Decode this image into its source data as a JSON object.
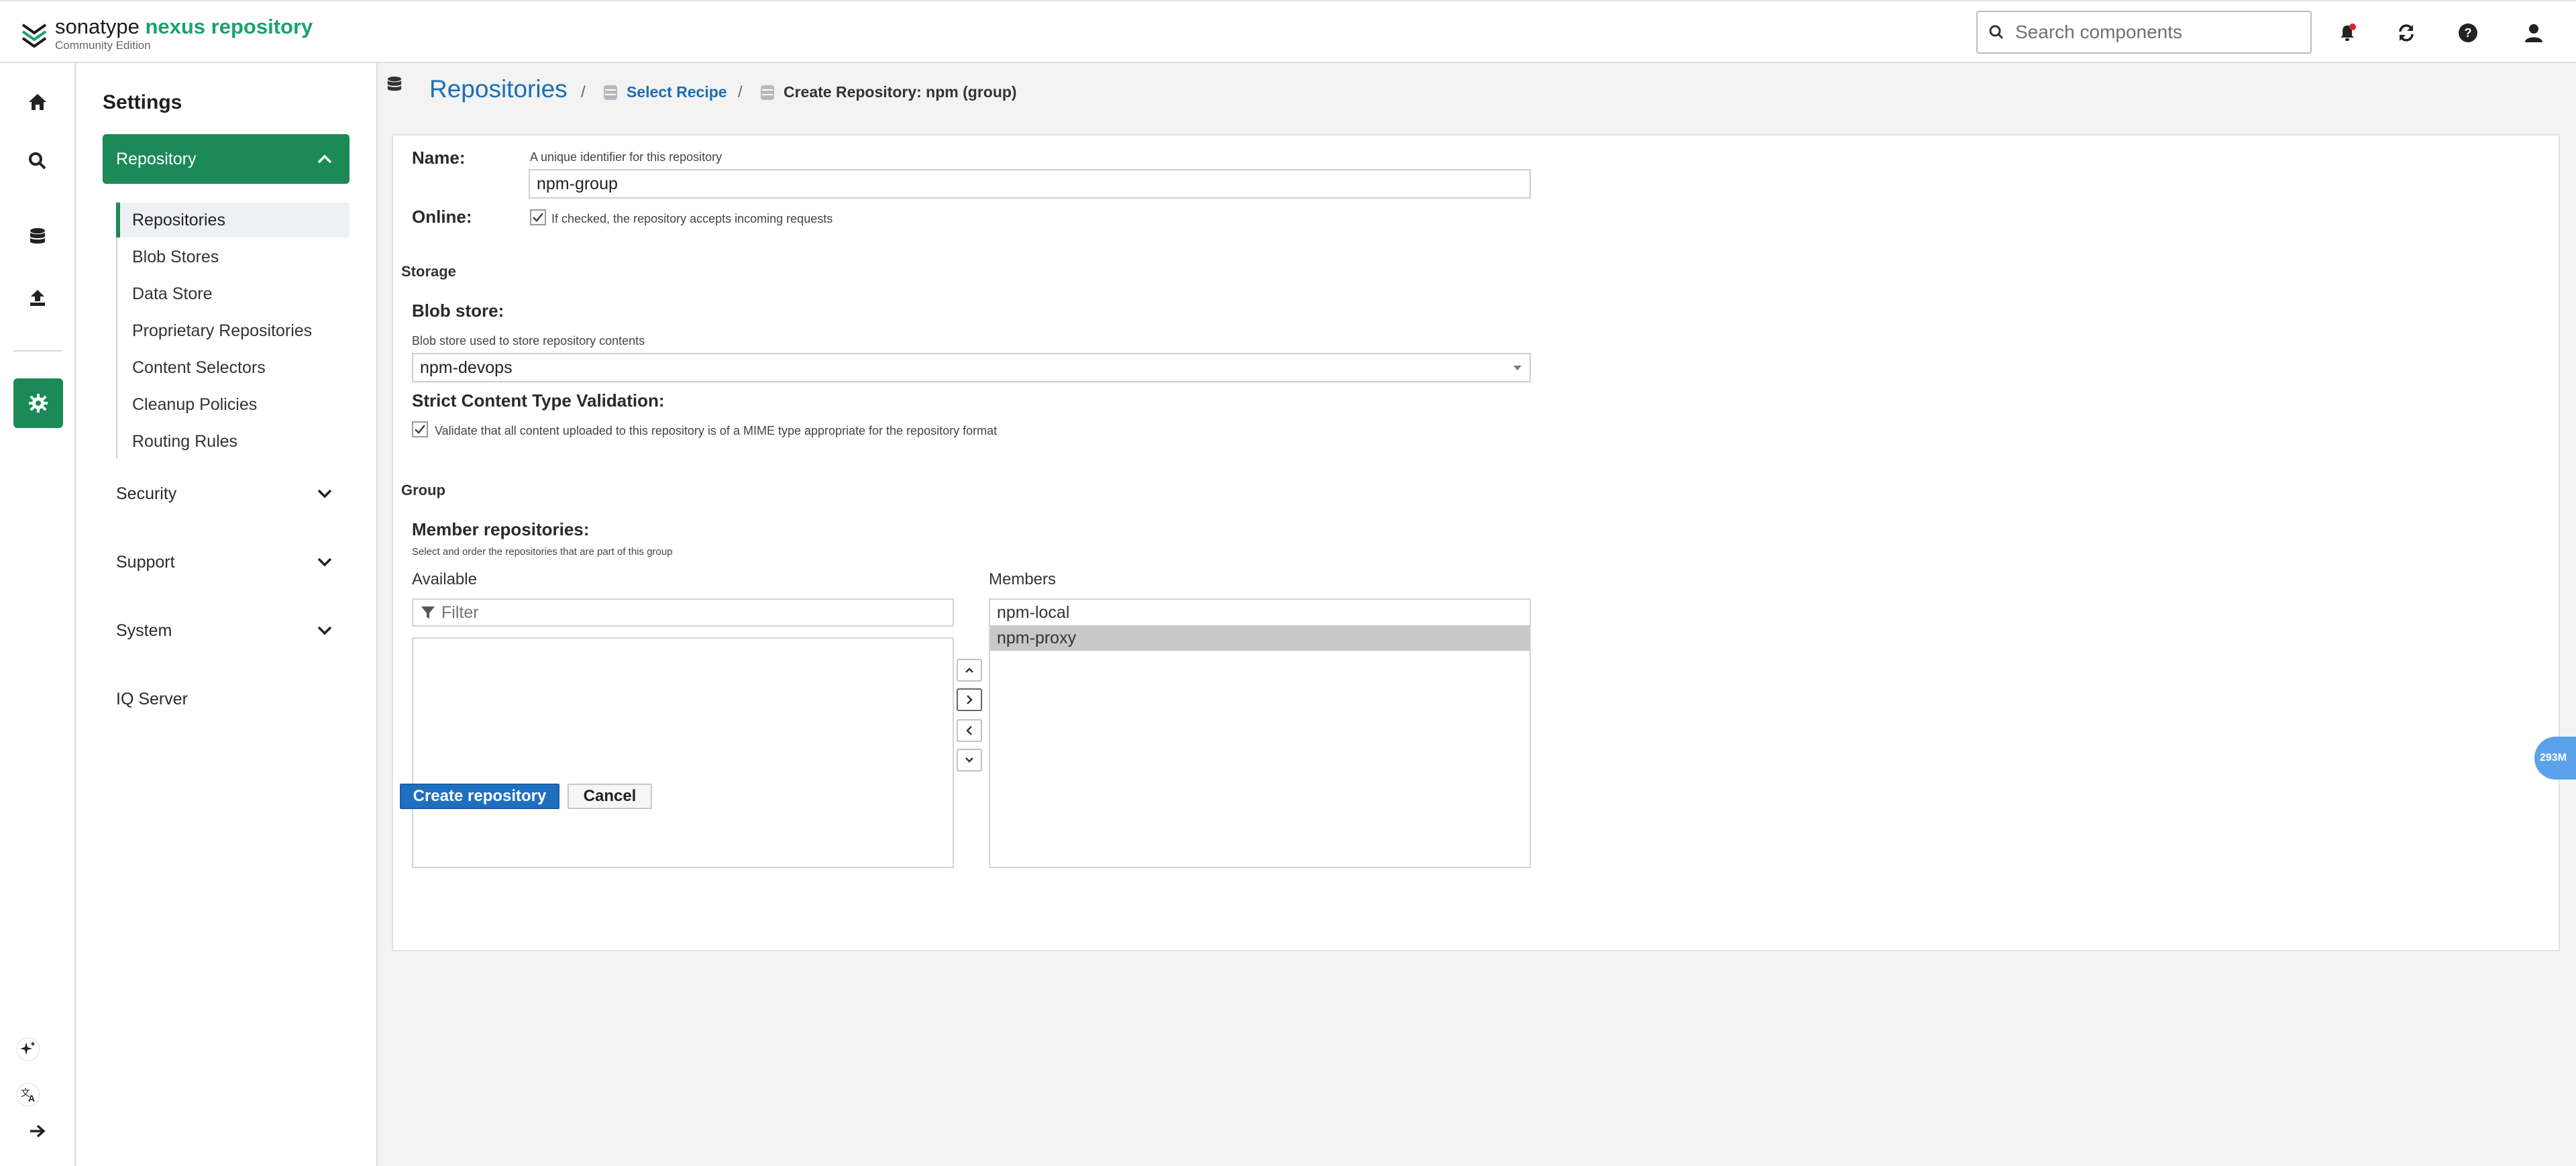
{
  "header": {
    "brand": "sonatype",
    "product": "nexus repository",
    "edition": "Community Edition",
    "search_placeholder": "Search components",
    "icons": [
      "bell-icon",
      "refresh-icon",
      "help-icon",
      "user-icon"
    ],
    "notification_dot_color": "#d9262c"
  },
  "rail": {
    "icons": [
      "home-icon",
      "search-icon",
      "database-icon",
      "upload-icon",
      "gear-icon",
      "sparkle-icon",
      "translate-icon",
      "arrow-right-icon"
    ],
    "active_color": "#1b8a57"
  },
  "nav": {
    "title": "Settings",
    "active_group": "Repository",
    "items": [
      {
        "label": "Repositories",
        "active": true
      },
      {
        "label": "Blob Stores"
      },
      {
        "label": "Data Store"
      },
      {
        "label": "Proprietary Repositories"
      },
      {
        "label": "Content Selectors"
      },
      {
        "label": "Cleanup Policies"
      },
      {
        "label": "Routing Rules"
      }
    ],
    "groups": [
      "Security",
      "Support",
      "System"
    ],
    "extra": "IQ Server"
  },
  "breadcrumb": {
    "root": "Repositories",
    "sep": "/",
    "step1": "Select Recipe",
    "step2": "Create Repository: npm (group)"
  },
  "form": {
    "name_label": "Name:",
    "name_help": "A unique identifier for this repository",
    "name_value": "npm-group",
    "online_label": "Online:",
    "online_help": "If checked, the repository accepts incoming requests",
    "online_checked": true,
    "storage_section": "Storage",
    "blob_label": "Blob store:",
    "blob_help": "Blob store used to store repository contents",
    "blob_value": "npm-devops",
    "strict_label": "Strict Content Type Validation:",
    "strict_help": "Validate that all content uploaded to this repository is of a MIME type appropriate for the repository format",
    "strict_checked": true,
    "group_section": "Group",
    "member_label": "Member repositories:",
    "member_help": "Select and order the repositories that are part of this group",
    "available_label": "Available",
    "filter_placeholder": "Filter",
    "members_label": "Members",
    "members": [
      "npm-local",
      "npm-proxy"
    ],
    "selected_member": "npm-proxy"
  },
  "actions": {
    "create": "Create repository",
    "cancel": "Cancel"
  },
  "memory_badge": "293M"
}
